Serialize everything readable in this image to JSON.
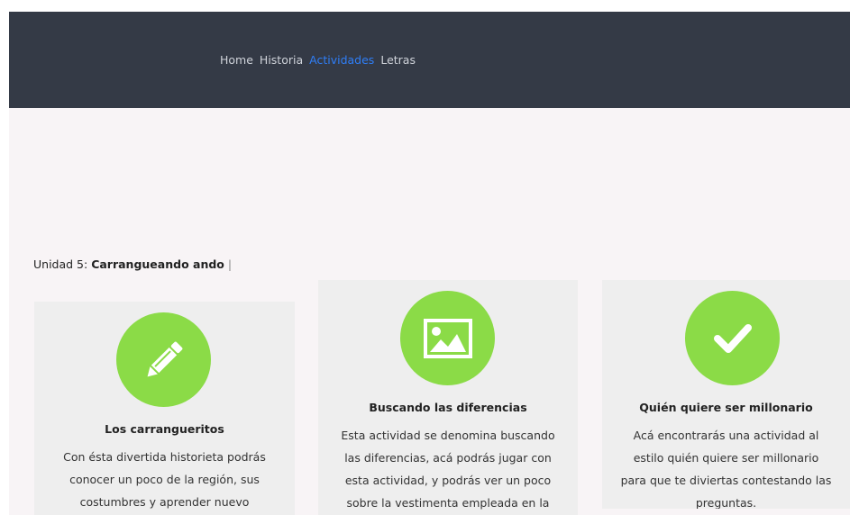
{
  "nav": {
    "items": [
      {
        "label": "Home",
        "active": false
      },
      {
        "label": "Historia",
        "active": false
      },
      {
        "label": "Actividades",
        "active": true
      },
      {
        "label": "Letras",
        "active": false
      }
    ]
  },
  "unit": {
    "prefix": "Unidad 5: ",
    "name": "Carrangueando ando",
    "suffix": " |"
  },
  "cards": [
    {
      "icon": "pencil-icon",
      "title": "Los carranguerito s",
      "description": "Con ésta divertida historieta podrás conocer un poco de la región, sus costumbres y aprender nuevo vocabulario."
    },
    {
      "icon": "image-icon",
      "title": "Buscando las diferencias",
      "description": "Esta actividad se denomina buscando las diferencias, acá podrás jugar con esta actividad, y podrás ver un poco sobre la vestimenta empleada en la Carranga"
    },
    {
      "icon": "checkmark-icon",
      "title": "Quién quiere ser millonario",
      "description": "Acá encontrarás una actividad al estilo quién quiere ser millonario para que te diviertas contestando las preguntas."
    }
  ],
  "colors": {
    "header_bg": "#343a46",
    "nav_text": "#cfd3da",
    "nav_active": "#2f7ef7",
    "accent_green": "#8bdb47",
    "card_bg": "#eeeeee",
    "content_bg": "#f8f4f6"
  }
}
